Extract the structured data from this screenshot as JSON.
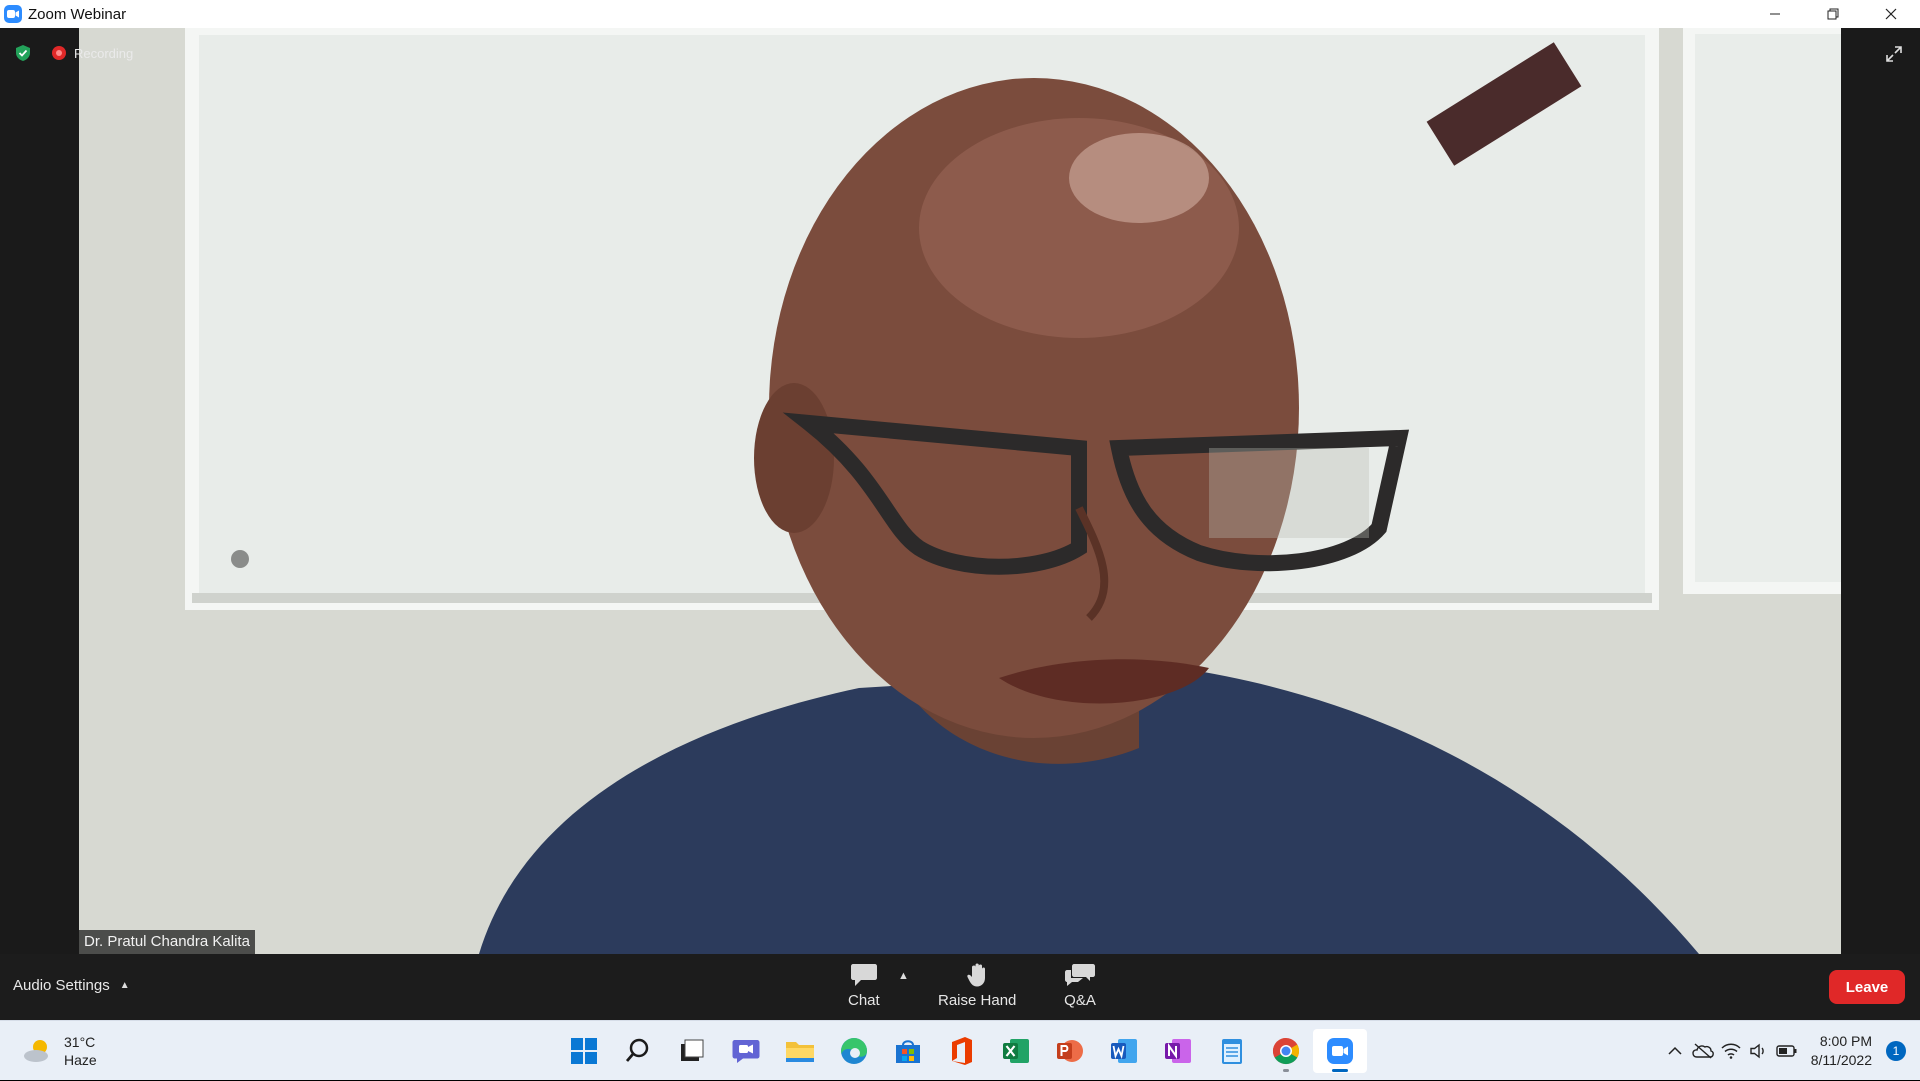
{
  "window": {
    "title": "Zoom Webinar",
    "controls": [
      "minimize",
      "restore",
      "close"
    ]
  },
  "meeting": {
    "recording_label": "Recording",
    "participant_name": "Dr. Pratul Chandra Kalita"
  },
  "controls": {
    "audio_settings_label": "Audio Settings",
    "chat_label": "Chat",
    "raise_hand_label": "Raise Hand",
    "qa_label": "Q&A",
    "leave_label": "Leave"
  },
  "taskbar": {
    "weather": {
      "temp": "31°C",
      "condition": "Haze"
    },
    "apps": [
      "windows-start",
      "search",
      "task-view",
      "teams-chat",
      "file-explorer",
      "edge",
      "microsoft-store",
      "office",
      "excel",
      "powerpoint",
      "word",
      "onenote",
      "notepad",
      "chrome",
      "zoom"
    ],
    "clock": {
      "time": "8:00 PM",
      "date": "8/11/2022"
    },
    "notification_count": "1"
  },
  "colors": {
    "zoom_blue": "#2d8cff",
    "leave_red": "#e02828",
    "control_bar": "#1c1c1c",
    "taskbar": "#e9eff7"
  }
}
